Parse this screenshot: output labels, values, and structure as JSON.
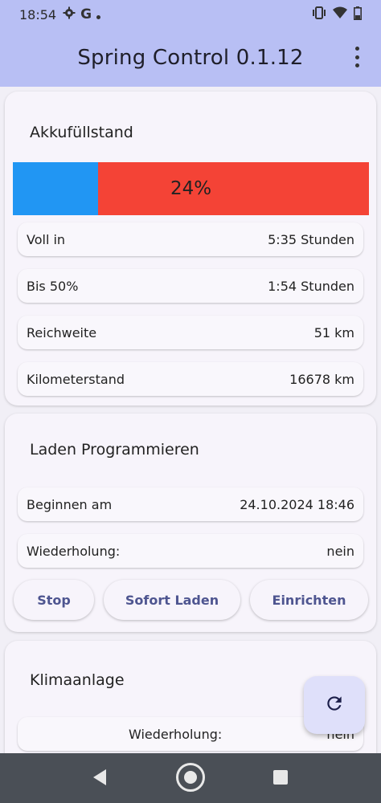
{
  "status": {
    "time": "18:54",
    "left_icons": [
      "gear-icon",
      "google-icon",
      "dot-icon"
    ],
    "right_icons": [
      "vibrate-icon",
      "wifi-icon",
      "battery-icon"
    ]
  },
  "app": {
    "title": "Spring Control 0.1.12"
  },
  "battery_card": {
    "title": "Akkufüllstand",
    "level_text": "24%",
    "level_fraction": 0.24,
    "colors": {
      "fill": "#2196f3",
      "empty": "#f44336"
    },
    "rows": [
      {
        "label": "Voll in",
        "value": "5:35 Stunden"
      },
      {
        "label": "Bis 50%",
        "value": "1:54 Stunden"
      },
      {
        "label": "Reichweite",
        "value": "51 km"
      },
      {
        "label": "Kilometerstand",
        "value": "16678 km"
      }
    ]
  },
  "charge_card": {
    "title": "Laden Programmieren",
    "rows": [
      {
        "label": "Beginnen am",
        "value": "24.10.2024 18:46"
      },
      {
        "label": "Wiederholung:",
        "value": "nein"
      }
    ],
    "buttons": {
      "stop": "Stop",
      "now": "Sofort Laden",
      "setup": "Einrichten"
    }
  },
  "climate_card": {
    "title": "Klimaanlage",
    "row": {
      "label": "Wiederholung:",
      "value": "nein"
    }
  },
  "fab": {
    "icon": "refresh-icon"
  },
  "nav": {
    "icons": [
      "back-icon",
      "home-icon",
      "recents-icon"
    ]
  }
}
